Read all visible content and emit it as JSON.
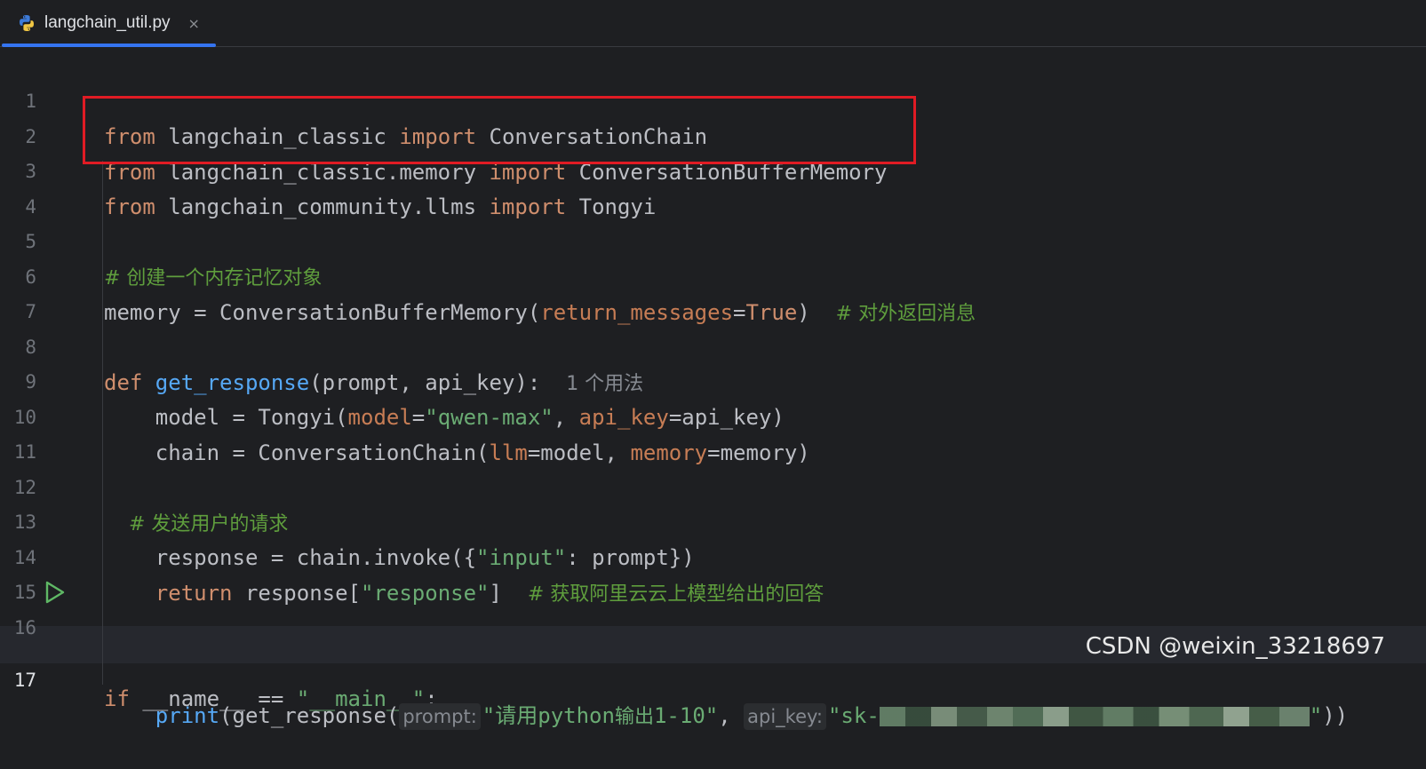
{
  "tab": {
    "label": "langchain_util.py",
    "close": "×"
  },
  "lines": [
    {
      "no": "1"
    },
    {
      "no": "2"
    },
    {
      "no": "3"
    },
    {
      "no": "4"
    },
    {
      "no": "5"
    },
    {
      "no": "6"
    },
    {
      "no": "7"
    },
    {
      "no": "8"
    },
    {
      "no": "9"
    },
    {
      "no": "10"
    },
    {
      "no": "11"
    },
    {
      "no": "12"
    },
    {
      "no": "13"
    },
    {
      "no": "14"
    },
    {
      "no": "15"
    },
    {
      "no": "16"
    },
    {
      "no": "17"
    }
  ],
  "code": {
    "l1": {
      "kw1": "from",
      "mod": " langchain_classic ",
      "kw2": "import",
      "name": " ConversationChain"
    },
    "l2": {
      "kw1": "from",
      "mod": " langchain_classic.memory ",
      "kw2": "import",
      "name": " ConversationBufferMemory"
    },
    "l3": {
      "kw1": "from",
      "mod": " langchain_community.llms ",
      "kw2": "import",
      "name": " Tongyi"
    },
    "l5": {
      "comment": "# 创建一个内存记忆对象"
    },
    "l6": {
      "a": "memory = ConversationBufferMemory(",
      "param": "return_messages",
      "eq": "=",
      "val": "True",
      "close": ")  ",
      "comment": "# 对外返回消息"
    },
    "l8": {
      "kw": "def",
      "fn": " get_response",
      "args": "(prompt, api_key):  ",
      "hint": "1 个用法"
    },
    "l9": {
      "a": "    model = Tongyi(",
      "p1": "model",
      "eq1": "=",
      "s1": "\"qwen-max\"",
      "mid": ", ",
      "p2": "api_key",
      "rest": "=api_key)"
    },
    "l10": {
      "a": "    chain = ConversationChain(",
      "p1": "llm",
      "m1": "=model, ",
      "p2": "memory",
      "rest": "=memory)"
    },
    "l12": {
      "comment": "    # 发送用户的请求"
    },
    "l13": {
      "a": "    response = chain.invoke({",
      "s": "\"input\"",
      "rest": ": prompt})"
    },
    "l14": {
      "kw": "    return",
      "a": " response[",
      "s": "\"response\"",
      "b": "]  ",
      "comment": "# 获取阿里云云上模型给出的回答"
    },
    "l16": {
      "kw": "if",
      "a": " __name__ == ",
      "s": "\"__main__\"",
      "b": ":"
    },
    "l17": {
      "fn": "    print",
      "a": "(get_response(",
      "h1": "prompt:",
      "s1a": "\"请用",
      "s1b": "python",
      "s1c": "输出",
      "s1d": "1-10\"",
      "sep": ", ",
      "h2": "api_key:",
      "s2a": "\"sk-",
      "s2b": "\"",
      "end": "))"
    }
  },
  "watermark": "CSDN @weixin_33218697",
  "colors": {
    "keyword": "#cf8e6d",
    "function": "#56a8f5",
    "string": "#6aab73",
    "param": "#c77d55",
    "comment": "#5f9e3d",
    "highlight_box": "#e01b24",
    "tab_indicator": "#3574f0"
  }
}
